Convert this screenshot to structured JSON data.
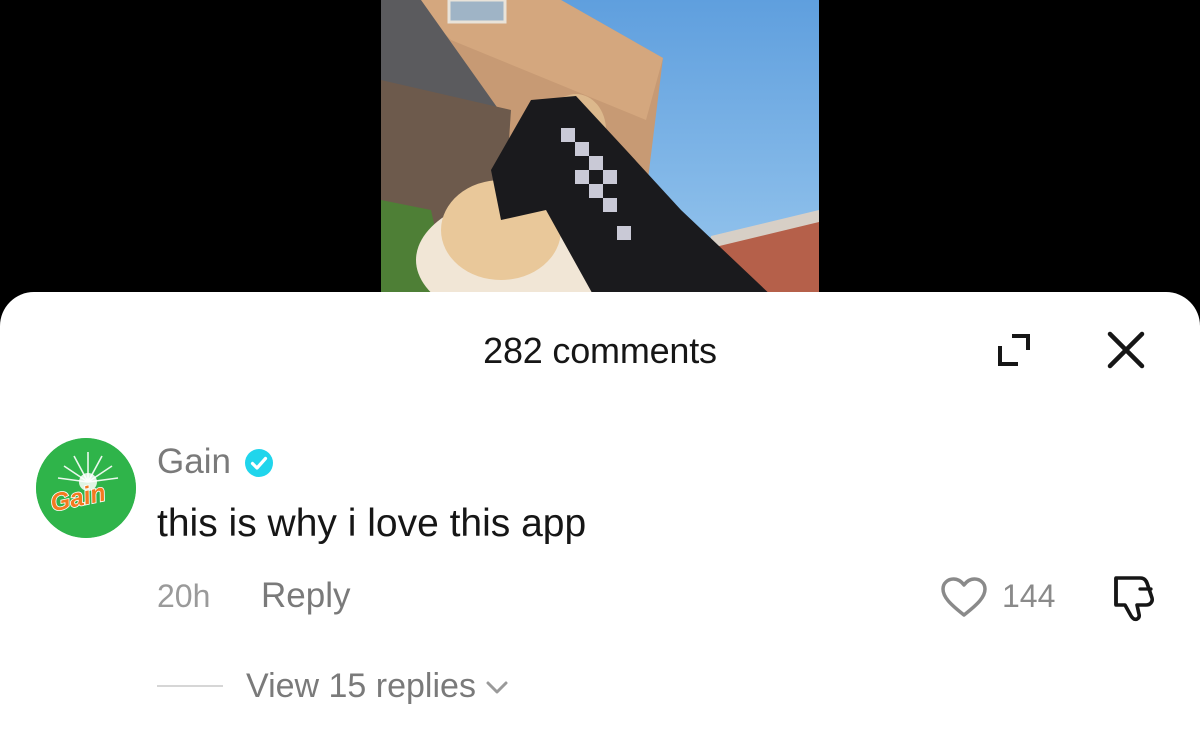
{
  "comments_panel": {
    "title": "282 comments",
    "expand_icon": "expand-icon",
    "close_icon": "close-icon"
  },
  "comment": {
    "avatar_logo_text": "Gain",
    "username": "Gain",
    "verified_icon": "verified-badge-icon",
    "text": "this is why i love this app",
    "time": "20h",
    "reply_label": "Reply",
    "like_icon": "heart-icon",
    "like_count": "144",
    "dislike_icon": "thumbs-down-icon",
    "view_replies_label": "View 15 replies",
    "view_replies_icon": "chevron-down-icon"
  },
  "colors": {
    "sheet_background": "#ffffff",
    "verified_blue": "#20d5ec",
    "gain_green": "#2fb44a",
    "gain_orange": "#f47a20",
    "muted_text": "#7a7a7a"
  }
}
